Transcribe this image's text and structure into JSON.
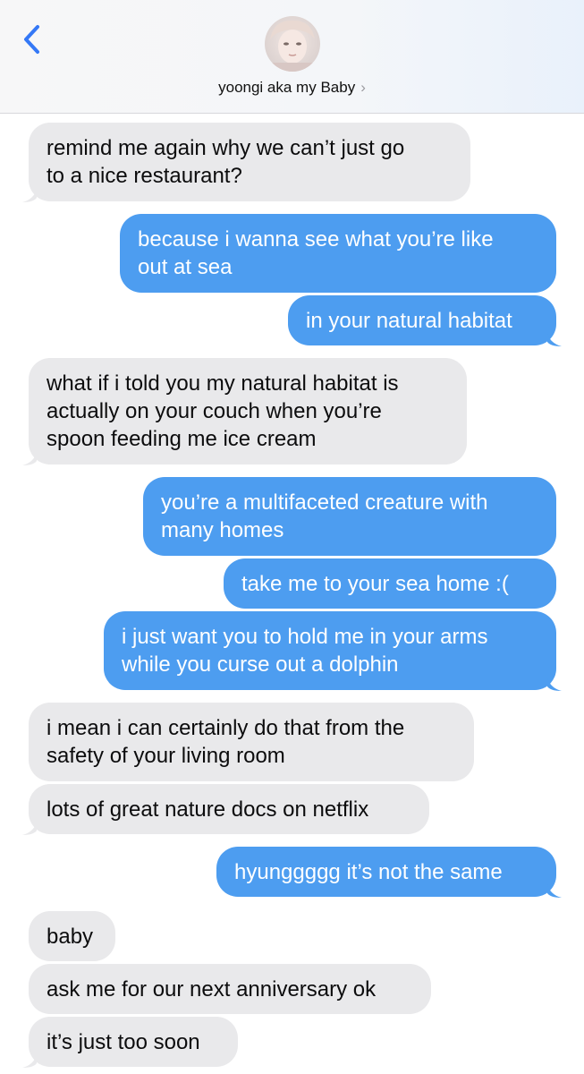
{
  "header": {
    "contact_name": "yoongi aka my Baby",
    "chevron": "›",
    "back_icon": "chevron-left-icon"
  },
  "colors": {
    "incoming_bubble": "#e9e9eb",
    "outgoing_bubble": "#4d9df0",
    "back_icon": "#3478f6"
  },
  "messages": [
    {
      "dir": "in",
      "text": "remind me again why we can’t just go\nto a nice restaurant?"
    },
    {
      "dir": "out",
      "text": "because i wanna see what you’re like\nout at sea"
    },
    {
      "dir": "out",
      "text": "in your natural habitat"
    },
    {
      "dir": "in",
      "text": "what if i told you my natural habitat is\nactually on your couch when you’re\nspoon feeding me ice cream"
    },
    {
      "dir": "out",
      "text": "you’re a multifaceted creature with\nmany homes"
    },
    {
      "dir": "out",
      "text": "take me to your sea home :("
    },
    {
      "dir": "out",
      "text": "i just want you to hold me in your arms\nwhile you curse out a dolphin"
    },
    {
      "dir": "in",
      "text": "i mean i can certainly do that from the\nsafety of your living room"
    },
    {
      "dir": "in",
      "text": "lots of great nature docs on netflix"
    },
    {
      "dir": "out",
      "text": "hyunggggg it’s not the same"
    },
    {
      "dir": "in",
      "text": "baby"
    },
    {
      "dir": "in",
      "text": "ask me for our next anniversary ok"
    },
    {
      "dir": "in",
      "text": "it’s just too soon"
    }
  ]
}
